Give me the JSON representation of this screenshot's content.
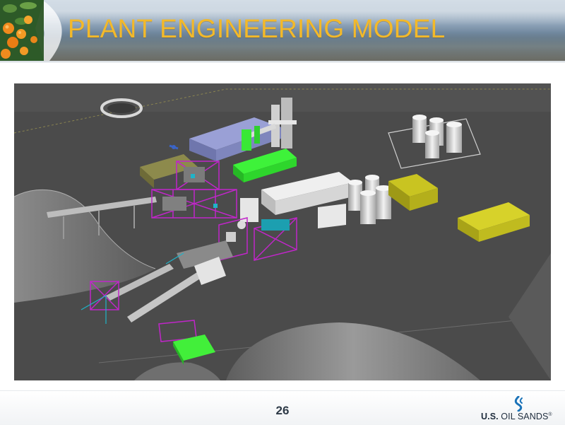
{
  "header": {
    "title": "PLANT ENGINEERING MODEL"
  },
  "main": {
    "image_subject": "3D plant engineering render"
  },
  "footer": {
    "page_number": "26",
    "logo": {
      "prefix": "U.S.",
      "name": "OIL SANDS",
      "mark": "®"
    }
  },
  "colors": {
    "title": "#f3b92a",
    "render_background": "#4b4b4b",
    "equipment_green": "#39e836",
    "equipment_magenta": "#c026c9",
    "building_yellow": "#b9b219",
    "building_lavender": "#8c93c9",
    "logo_blue": "#1b73b8"
  },
  "icons": [
    "oranges-decoration",
    "render-image",
    "oil-sands-logo-mark"
  ]
}
